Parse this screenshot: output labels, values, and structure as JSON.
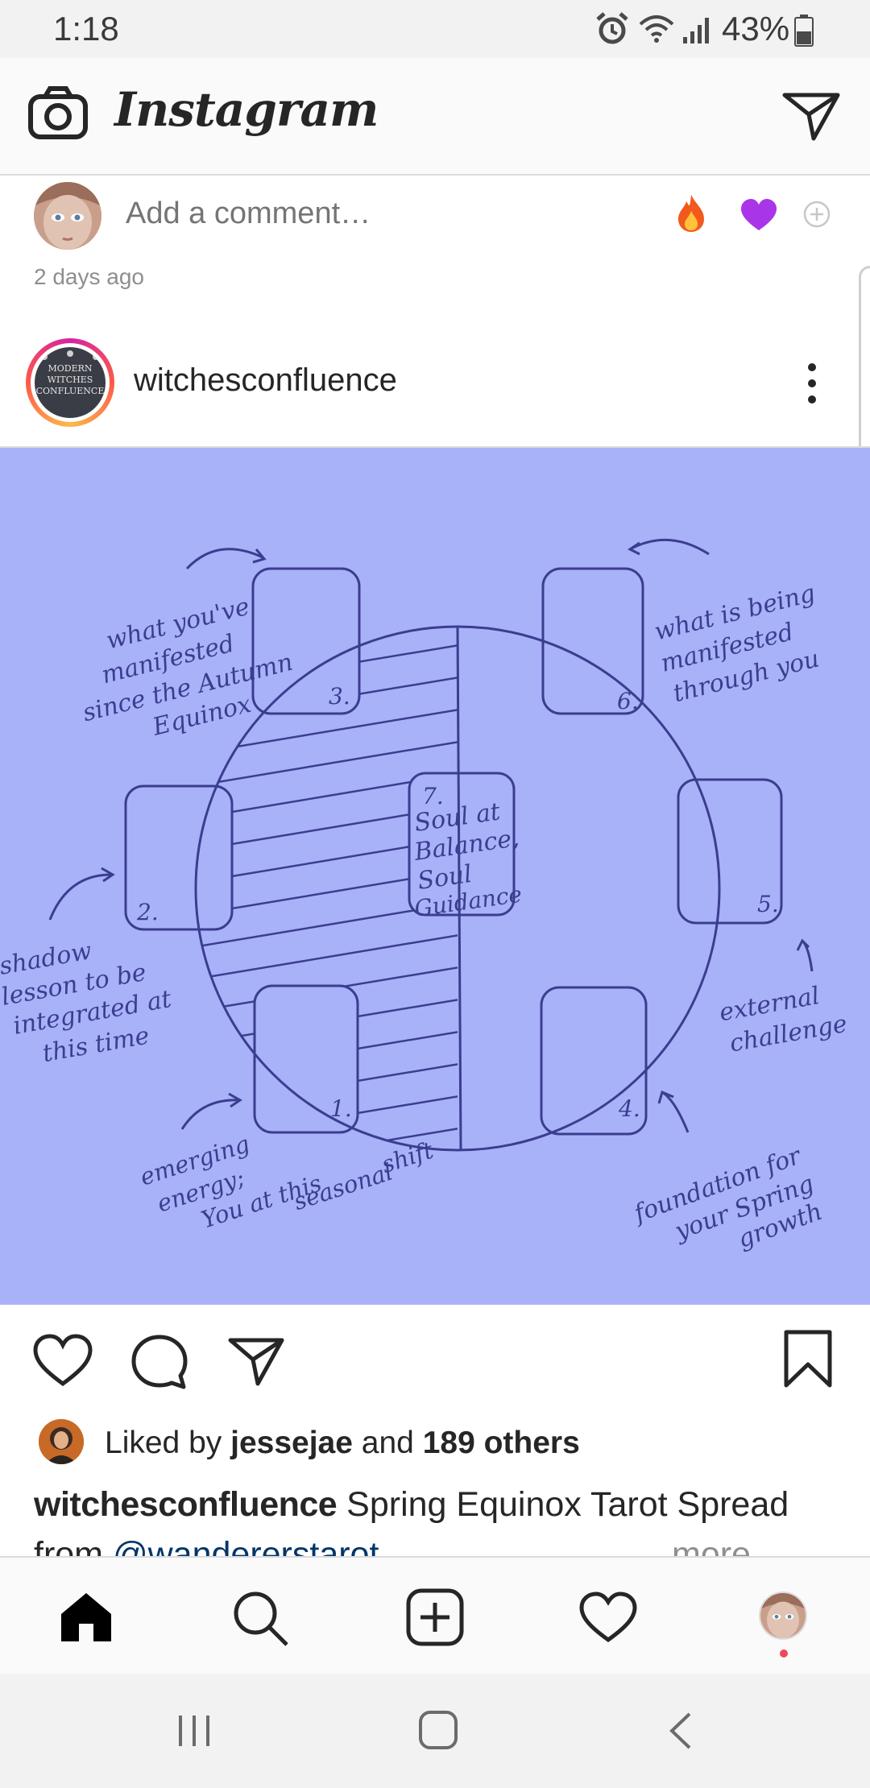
{
  "status_bar": {
    "time": "1:18",
    "battery_percent": "43%"
  },
  "header": {
    "app_title": "Instagram"
  },
  "comment_box": {
    "placeholder": "Add a comment…",
    "reactions": [
      "fire",
      "purple-heart",
      "add"
    ]
  },
  "previous_post": {
    "time_ago": "2 days ago"
  },
  "post": {
    "username": "witchesconfluence",
    "avatar_text": [
      "MODERN",
      "WITCHES",
      "CONFLUENCE"
    ],
    "image": {
      "background": "#a8b2f8",
      "ink": "#3b3d8f",
      "center_card": {
        "number": "7.",
        "text": [
          "Soul at",
          "Balance,",
          "Soul",
          "Guidance"
        ]
      },
      "cards": [
        {
          "number": "1.",
          "note": [
            "emerging",
            "energy;",
            "You at this",
            "seasonal",
            "shift"
          ]
        },
        {
          "number": "2.",
          "note": [
            "shadow",
            "lesson to be",
            "integrated at",
            "this time"
          ]
        },
        {
          "number": "3.",
          "note": [
            "what you've",
            "manifested",
            "since the Autumn",
            "Equinox"
          ]
        },
        {
          "number": "4.",
          "note": [
            "foundation for",
            "your Spring",
            "growth"
          ]
        },
        {
          "number": "5.",
          "note": [
            "external",
            "challenge"
          ]
        },
        {
          "number": "6.",
          "note": [
            "what is being",
            "manifested",
            "through you"
          ]
        }
      ]
    },
    "liked_by_prefix": "Liked by",
    "liked_by_user": "jessejae",
    "liked_by_and": "and",
    "liked_by_others": "189 others",
    "caption_user": "witchesconfluence",
    "caption_text": "Spring Equinox Tarot Spread",
    "caption_from": "from",
    "caption_link": "@wandererstarot",
    "caption_more": "more"
  },
  "bottom_nav": {
    "items": [
      "home",
      "search",
      "new-post",
      "activity",
      "profile"
    ]
  },
  "colors": {
    "accent_red": "#ed4956",
    "link": "#003569"
  }
}
